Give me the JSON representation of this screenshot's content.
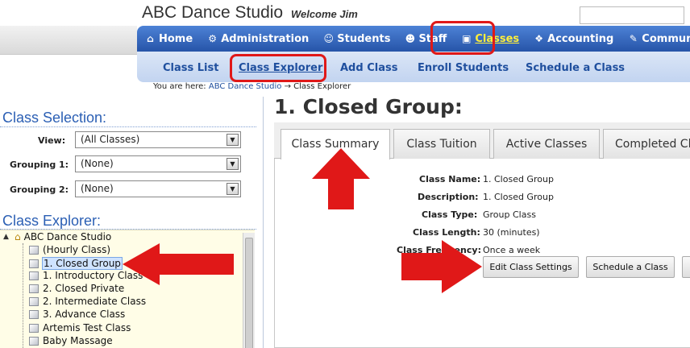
{
  "header": {
    "brand": "ABC Dance Studio",
    "welcome": "Welcome Jim"
  },
  "nav": {
    "items": [
      {
        "label": "Home",
        "icon": "home-icon",
        "glyph": "⌂"
      },
      {
        "label": "Administration",
        "icon": "gear-icon",
        "glyph": "⚙"
      },
      {
        "label": "Students",
        "icon": "students-icon",
        "glyph": "☺"
      },
      {
        "label": "Staff",
        "icon": "staff-icon",
        "glyph": "☻"
      },
      {
        "label": "Classes",
        "icon": "classes-icon",
        "glyph": "▣"
      },
      {
        "label": "Accounting",
        "icon": "money-icon",
        "glyph": "❖"
      },
      {
        "label": "Communication",
        "icon": "communication-icon",
        "glyph": "✎"
      }
    ],
    "active": "Classes"
  },
  "subnav": {
    "items": [
      "Class List",
      "Class Explorer",
      "Add Class",
      "Enroll Students",
      "Schedule a Class"
    ],
    "active": "Class Explorer"
  },
  "breadcrumb": {
    "prefix": "You are here:",
    "link": "ABC Dance Studio",
    "arrow": "→",
    "current": "Class Explorer"
  },
  "selection": {
    "title": "Class Selection:",
    "fields": [
      {
        "label": "View:",
        "value": "(All Classes)"
      },
      {
        "label": "Grouping 1:",
        "value": "(None)"
      },
      {
        "label": "Grouping 2:",
        "value": "(None)"
      }
    ]
  },
  "explorer": {
    "title": "Class Explorer:",
    "root": "ABC Dance Studio",
    "items": [
      "(Hourly Class)",
      "1. Closed Group",
      "1. Introductory Class",
      "2. Closed Private",
      "2. Intermediate Class",
      "3. Advance Class",
      "Artemis Test Class",
      "Baby Massage"
    ],
    "selected": "1. Closed Group"
  },
  "detail": {
    "title": "1. Closed Group:",
    "tabs": [
      "Class Summary",
      "Class Tuition",
      "Active Classes",
      "Completed Cl"
    ],
    "active_tab": "Class Summary",
    "fields": [
      {
        "label": "Class Name:",
        "value": "1. Closed Group"
      },
      {
        "label": "Description:",
        "value": "1. Closed Group"
      },
      {
        "label": "Class Type:",
        "value": "Group Class"
      },
      {
        "label": "Class Length:",
        "value": "30 (minutes)"
      },
      {
        "label": "Class Frequency:",
        "value": "Once a week"
      }
    ],
    "buttons": [
      "Edit Class Settings",
      "Schedule a Class"
    ]
  },
  "colors": {
    "nav_blue": "#2a5bb0",
    "link_blue": "#1f4f9e",
    "annotation_red": "#e01818",
    "active_nav_text": "#ffef3a"
  }
}
